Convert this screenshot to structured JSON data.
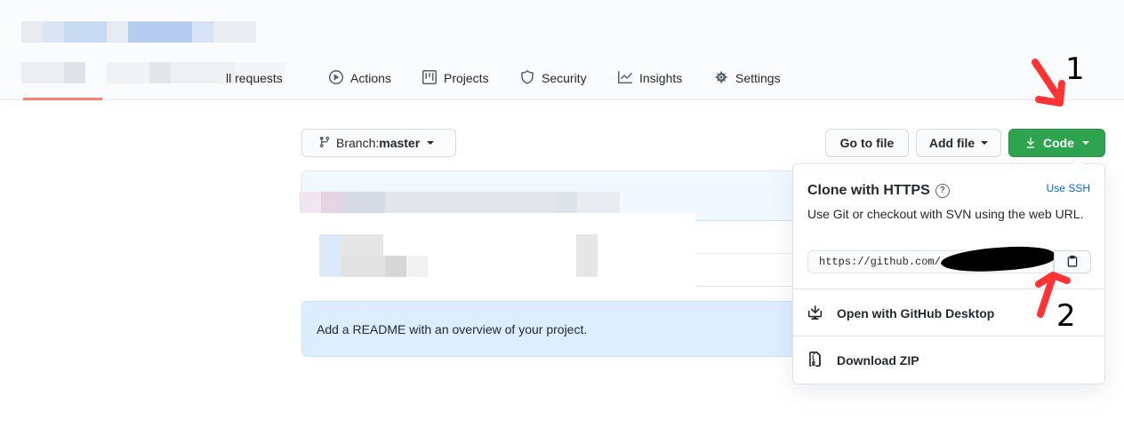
{
  "nav": {
    "tabs": [
      {
        "label": "Pull requests",
        "icon": "pull-request-icon"
      },
      {
        "label": "Actions",
        "icon": "play-icon"
      },
      {
        "label": "Projects",
        "icon": "project-icon"
      },
      {
        "label": "Security",
        "icon": "shield-icon"
      },
      {
        "label": "Insights",
        "icon": "graph-icon"
      },
      {
        "label": "Settings",
        "icon": "gear-icon"
      }
    ],
    "pull_requests_partial": "ll requests"
  },
  "branch": {
    "prefix": "Branch: ",
    "name": "master"
  },
  "toolbar": {
    "go_to_file": "Go to file",
    "add_file": "Add file",
    "code": "Code"
  },
  "readme": {
    "text": "Add a README with an overview of your project."
  },
  "clone": {
    "title": "Clone with HTTPS",
    "use_ssh": "Use SSH",
    "description": "Use Git or checkout with SVN using the web URL.",
    "url": "https://github.com/",
    "open_desktop": "Open with GitHub Desktop",
    "download_zip": "Download ZIP"
  },
  "annotations": {
    "one": "1",
    "two": "2"
  },
  "colors": {
    "code_button": "#2ea44f",
    "annotation_arrow": "#ff3333",
    "link": "#0366d6",
    "selected_tab_underline": "#f9826c"
  }
}
